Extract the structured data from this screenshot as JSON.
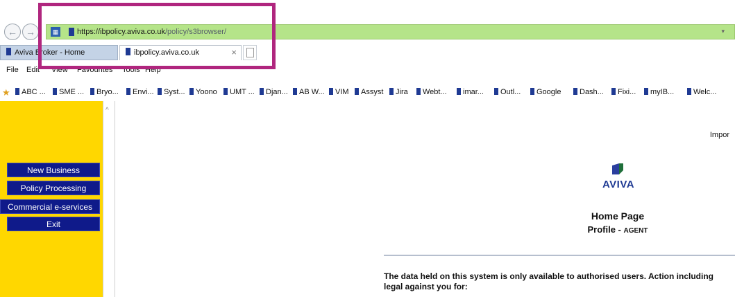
{
  "browser": {
    "url_prefix": "https://",
    "url_host": "ibpolicy.aviva.co.uk",
    "url_path": "/policy/s3browser/",
    "tabs": [
      {
        "label": "Aviva Broker - Home"
      },
      {
        "label": "ibpolicy.aviva.co.uk"
      }
    ],
    "menu": [
      "File",
      "Edit",
      "View",
      "Favourites",
      "Tools",
      "Help"
    ],
    "favourites": [
      "ABC ...",
      "SME ...",
      "Bryo...",
      "Envi...",
      "Syst...",
      "Yoono",
      "UMT ...",
      "Djan...",
      "AB W...",
      "VIM",
      "Assyst",
      "Jira",
      "Webt...",
      "imar...",
      "Outl...",
      "Google",
      "Dash...",
      "Fixi...",
      "myIB...",
      "Welc..."
    ]
  },
  "sidebar": {
    "buttons": [
      "New Business",
      "Policy Processing",
      "Commercial e-services",
      "Exit"
    ]
  },
  "main": {
    "top_right": "Impor",
    "brand": "AVIVA",
    "title": "Home Page",
    "profile_label": "Profile - ",
    "profile_value": "AGENT",
    "notice": "The data held on this system is only available to authorised users. Action including legal against you for:"
  },
  "colors": {
    "sidebar": "#ffd700",
    "menu_button": "#0f1a8a",
    "brand": "#1f3a93",
    "highlight": "#b0267e",
    "address_bar": "#b5e489"
  }
}
